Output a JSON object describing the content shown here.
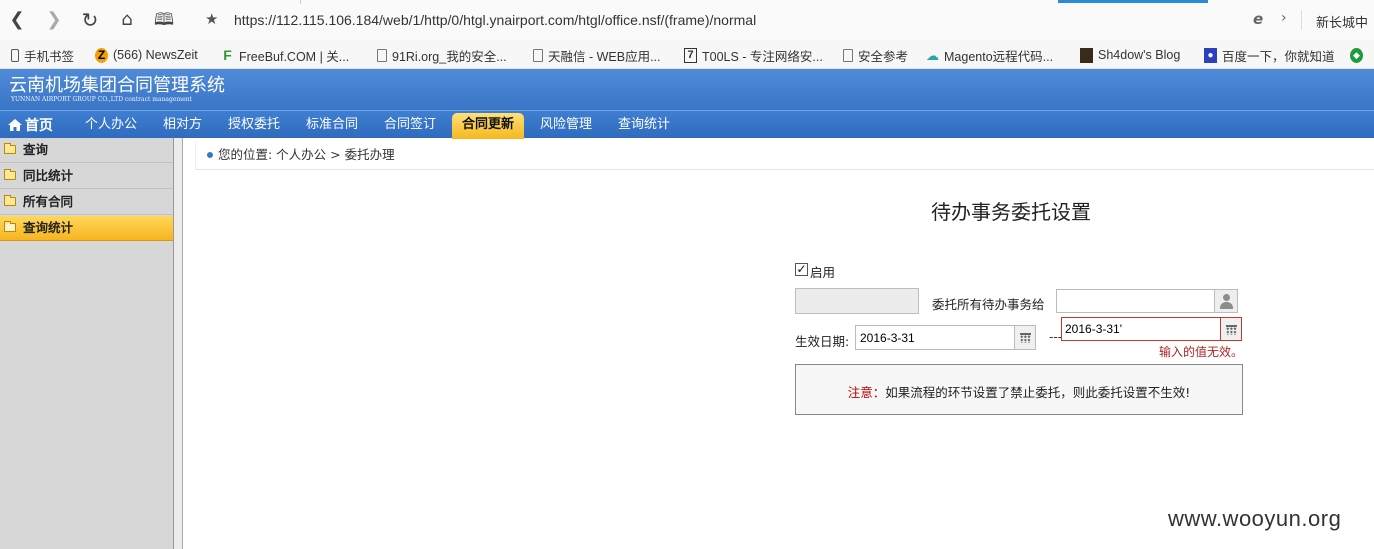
{
  "browser": {
    "url": "https://112.115.106.184/web/1/http/0/htgl.ynairport.com/htgl/office.nsf/(frame)/normal",
    "right_label": "新长城中",
    "bookmarks": [
      {
        "label": "手机书签",
        "icon": "phone-icon"
      },
      {
        "label": "(566) NewsZeit",
        "icon": "newszeit-icon"
      },
      {
        "label": "FreeBuf.COM | 关...",
        "icon": "freebuf-icon"
      },
      {
        "label": "91Ri.org_我的安全...",
        "icon": "page-icon"
      },
      {
        "label": "天融信 - WEB应用...",
        "icon": "page-icon"
      },
      {
        "label": "T00LS - 专注网络安...",
        "icon": "t00ls-icon"
      },
      {
        "label": "安全参考",
        "icon": "page-icon"
      },
      {
        "label": "Magento远程代码...",
        "icon": "cloud-icon"
      },
      {
        "label": "Sh4dow's Blog",
        "icon": "blog-icon"
      },
      {
        "label": "百度一下，你就知道",
        "icon": "baidu-icon"
      }
    ]
  },
  "app": {
    "title": "云南机场集团合同管理系统",
    "subtitle": "YUNNAN AIRPORT GROUP CO.,LTD contract management"
  },
  "menu": {
    "home": "首页",
    "items": [
      "个人办公",
      "相对方",
      "授权委托",
      "标准合同",
      "合同签订",
      "合同更新",
      "风险管理",
      "查询统计"
    ],
    "active": "合同更新"
  },
  "sidebar": {
    "items": [
      "查询",
      "同比统计",
      "所有合同",
      "查询统计"
    ],
    "active": "查询统计"
  },
  "breadcrumb": "您的位置: 个人办公 > 委托办理",
  "form": {
    "heading": "待办事务委托设置",
    "enable_label": "启用",
    "enable_checked": true,
    "delegate_label": "委托所有待办事务给",
    "delegate_value": "",
    "start_date_label": "生效日期:",
    "start_date": "2016-3-31",
    "range_separator": "---",
    "end_date": "2016-3-31'",
    "invalid_message": "输入的值无效。",
    "notice_prefix": "注意：",
    "notice_text": "如果流程的环节设置了禁止委托，则此委托设置不生效!"
  },
  "watermark": "www.wooyun.org"
}
